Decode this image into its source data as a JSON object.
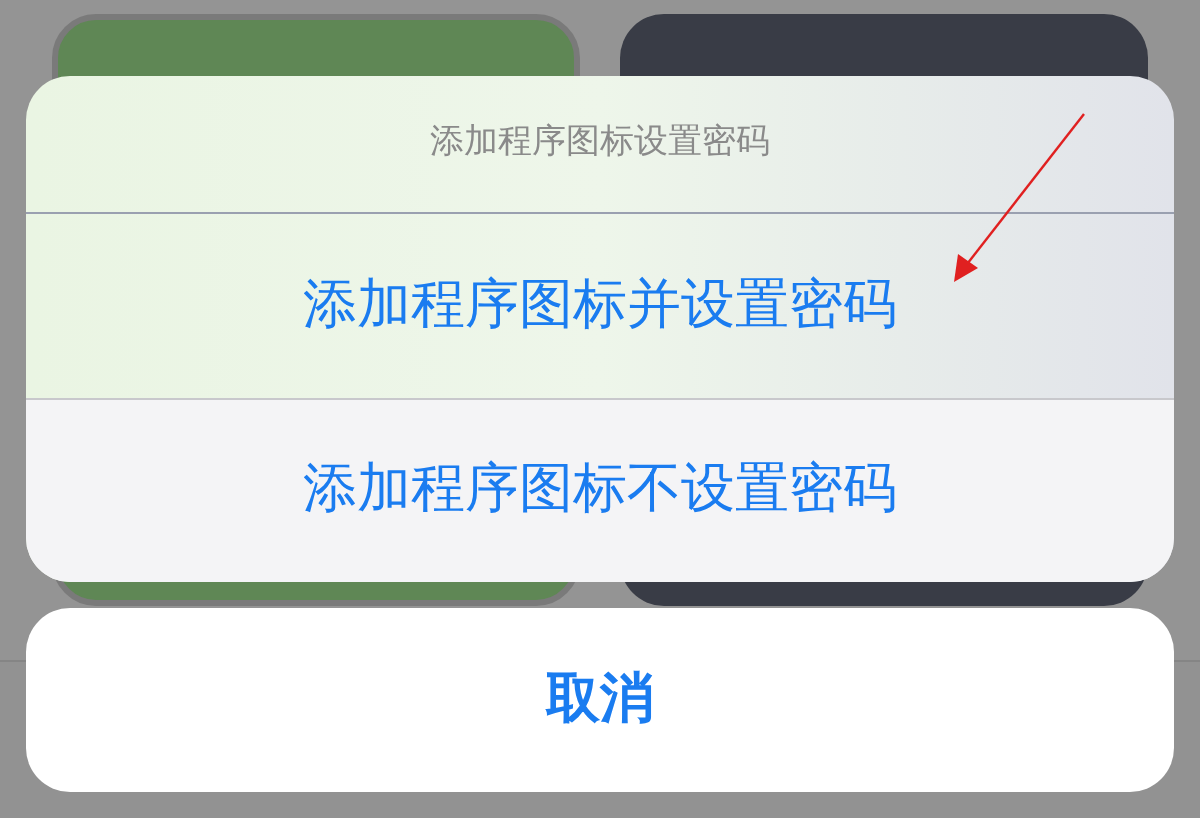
{
  "action_sheet": {
    "title": "添加程序图标设置密码",
    "options": [
      "添加程序图标并设置密码",
      "添加程序图标不设置密码"
    ],
    "cancel": "取消"
  }
}
